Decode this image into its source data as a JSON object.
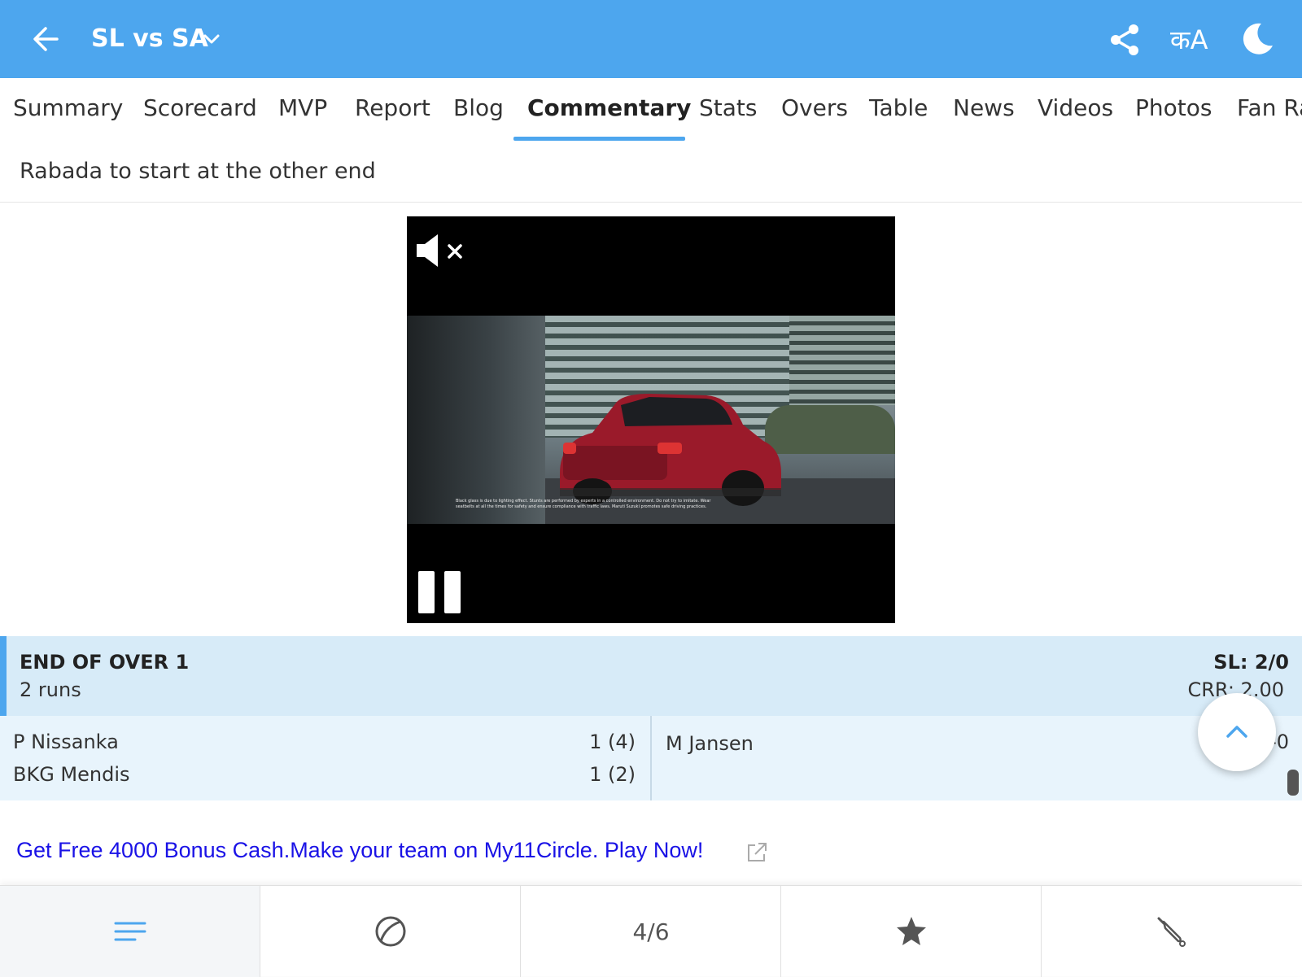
{
  "header": {
    "match_title": "SL vs SA",
    "lang_label": "कA",
    "icons": [
      "back-arrow-icon",
      "chevron-down-icon",
      "share-icon",
      "language-icon",
      "moon-icon"
    ]
  },
  "tabs": [
    {
      "label": "Summary"
    },
    {
      "label": "Scorecard"
    },
    {
      "label": "MVP"
    },
    {
      "label": "Report"
    },
    {
      "label": "Blog"
    },
    {
      "label": "Commentary",
      "active": true
    },
    {
      "label": "Stats"
    },
    {
      "label": "Overs"
    },
    {
      "label": "Table"
    },
    {
      "label": "News"
    },
    {
      "label": "Videos"
    },
    {
      "label": "Photos"
    },
    {
      "label": "Fan Ra"
    }
  ],
  "commentary": {
    "text": "Rabada to start at the other end"
  },
  "video_ad": {
    "disclaimer": "Black glass is due to lighting effect. Stunts are performed by experts in a controlled environment. Do not try to imitate. Wear seatbelts at all the times for safety and ensure compliance with traffic laws. Maruti Suzuki promotes safe driving practices.",
    "state": "playing",
    "muted": true
  },
  "over_summary": {
    "heading": "END OF OVER 1",
    "runs": "2 runs",
    "score": "SL: 2/0",
    "crr": "CRR: 2.00"
  },
  "batters": [
    {
      "name": "P Nissanka",
      "figures": "1 (4)"
    },
    {
      "name": "BKG Mendis",
      "figures": "1 (2)"
    }
  ],
  "bowler": {
    "name": "M Jansen",
    "figures": "-0"
  },
  "promo": {
    "text": "Get Free 4000 Bonus Cash.Make your team on My11Circle. Play Now!"
  },
  "bottom_nav": {
    "count_label": "4/6",
    "items": [
      "menu-icon",
      "ball-icon",
      "count",
      "star-icon",
      "bat-icon"
    ]
  },
  "colors": {
    "header_bg": "#4da6ee",
    "over_bg": "#d7ebf8",
    "players_bg": "#e8f4fc",
    "promo_link": "#1a12e6"
  }
}
